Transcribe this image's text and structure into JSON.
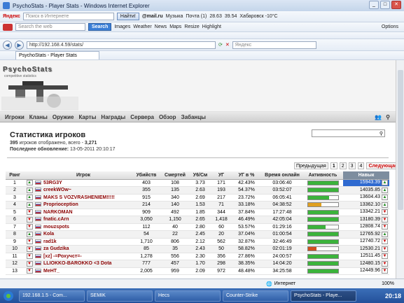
{
  "window": {
    "title": "PsychoStats - Player Stats - Windows Internet Explorer"
  },
  "toolbar1": {
    "yandex": "Яндекс",
    "search_placeholder": "Поиск в Интернете",
    "find_btn": "Найти!",
    "mail": "@mail.ru",
    "music": "Музыка",
    "mailbox": "Почта (1)",
    "rate1": "28.63",
    "rate2": "39.54",
    "weather": "Хабаровск -10°C"
  },
  "toolbar2": {
    "search_placeholder": "Search the web",
    "search_btn": "Search",
    "images": "Images",
    "weather": "Weather",
    "news": "News",
    "maps": "Maps",
    "resize": "Resize",
    "highlight": "Highlight",
    "options": "Options"
  },
  "address": {
    "url": "http://192.168.4.59/stats/",
    "search_placeholder": "Яндекс"
  },
  "tab": {
    "label": "PsychoStats - Player Stats"
  },
  "site": {
    "logo": "PsychoStats",
    "logo_sub": "competitive statistics",
    "nav": [
      "Игроки",
      "Кланы",
      "Оружие",
      "Карты",
      "Награды",
      "Сервера",
      "Обзор",
      "Забанцы"
    ]
  },
  "stats": {
    "title": "Статистика игроков",
    "shown": "395",
    "shown_text": "игроков отображено, всего -",
    "total": "3,271",
    "updated_label": "Последнее обновление:",
    "updated_value": "13-05-2011 20:10:17"
  },
  "pager": {
    "prev": "Предыдущая",
    "pages": [
      "1",
      "2",
      "3",
      "4"
    ],
    "next": "Следующая"
  },
  "table": {
    "headers": [
      "Ранг",
      "",
      "Игрок",
      "Убийств",
      "Смертей",
      "У6/См",
      "УГ",
      "УГ в %",
      "Время онлайн",
      "Активность",
      "Навык"
    ],
    "rows": [
      {
        "rank": "1",
        "dir": "up",
        "name": "53RG3Y",
        "kills": "403",
        "deaths": "108",
        "kd": "3.73",
        "hs": "171",
        "hsp": "42.43%",
        "time": "03:06:40",
        "act": 1.0,
        "actcolor": "#3bb33b",
        "skill": "15943.39"
      },
      {
        "rank": "2",
        "dir": "up",
        "name": "creekWOw~",
        "kills": "355",
        "deaths": "135",
        "kd": "2.63",
        "hs": "193",
        "hsp": "54.37%",
        "time": "03:52:07",
        "act": 1.0,
        "actcolor": "#3bb33b",
        "skill": "14035.85"
      },
      {
        "rank": "3",
        "dir": "up",
        "name": "MAKS S VOZVRASHENIEM!!!!!",
        "kills": "915",
        "deaths": "340",
        "kd": "2.69",
        "hs": "217",
        "hsp": "23.72%",
        "time": "06:05:41",
        "act": 0.72,
        "actcolor": "#3bb33b",
        "skill": "13604.43"
      },
      {
        "rank": "4",
        "dir": "up",
        "name": "Proprioception",
        "kills": "214",
        "deaths": "140",
        "kd": "1.53",
        "hs": "71",
        "hsp": "33.18%",
        "time": "04:38:52",
        "act": 0.45,
        "actcolor": "#e0a020",
        "skill": "13362.10"
      },
      {
        "rank": "5",
        "dir": "dn",
        "name": "NARKOMAN",
        "kills": "909",
        "deaths": "492",
        "kd": "1.85",
        "hs": "344",
        "hsp": "37.84%",
        "time": "17:27:48",
        "act": 1.0,
        "actcolor": "#3bb33b",
        "skill": "13342.21"
      },
      {
        "rank": "6",
        "dir": "dn",
        "name": "fnatic.cArn",
        "kills": "3,050",
        "deaths": "1,150",
        "kd": "2.65",
        "hs": "1,418",
        "hsp": "46.49%",
        "time": "42:05:04",
        "act": 1.0,
        "actcolor": "#3bb33b",
        "skill": "13180.39"
      },
      {
        "rank": "7",
        "dir": "dn",
        "name": "mouzspots",
        "kills": "112",
        "deaths": "40",
        "kd": "2.80",
        "hs": "60",
        "hsp": "53.57%",
        "time": "01:29:16",
        "act": 0.6,
        "actcolor": "#3bb33b",
        "skill": "12808.74"
      },
      {
        "rank": "8",
        "dir": "up",
        "name": "Kola",
        "kills": "54",
        "deaths": "22",
        "kd": "2.45",
        "hs": "20",
        "hsp": "37.04%",
        "time": "01:00:54",
        "act": 1.0,
        "actcolor": "#3bb33b",
        "skill": "12765.92"
      },
      {
        "rank": "9",
        "dir": "dn",
        "name": "rad1k",
        "kills": "1,710",
        "deaths": "806",
        "kd": "2.12",
        "hs": "562",
        "hsp": "32.87%",
        "time": "32:46:49",
        "act": 1.0,
        "actcolor": "#3bb33b",
        "skill": "12740.72"
      },
      {
        "rank": "10",
        "dir": "dn",
        "name": "za Gudzika",
        "kills": "85",
        "deaths": "35",
        "kd": "2.43",
        "hs": "50",
        "hsp": "58.82%",
        "time": "02:01:19",
        "act": 0.3,
        "actcolor": "#d05020",
        "skill": "12530.21"
      },
      {
        "rank": "11",
        "dir": "dn",
        "name": "[xz] -=Рохучст=-",
        "kills": "1,278",
        "deaths": "556",
        "kd": "2.30",
        "hs": "356",
        "hsp": "27.86%",
        "time": "24:00:57",
        "act": 1.0,
        "actcolor": "#3bb33b",
        "skill": "12511.45"
      },
      {
        "rank": "12",
        "dir": "dn",
        "name": "LLIOKKO-BAROKKO <3 Dota",
        "kills": "777",
        "deaths": "457",
        "kd": "1.70",
        "hs": "298",
        "hsp": "38.35%",
        "time": "14:04:20",
        "act": 1.0,
        "actcolor": "#3bb33b",
        "skill": "12480.15"
      },
      {
        "rank": "13",
        "dir": "dn",
        "name": "MeHT_",
        "kills": "2,005",
        "deaths": "959",
        "kd": "2.09",
        "hs": "972",
        "hsp": "48.48%",
        "time": "34:25:58",
        "act": 1.0,
        "actcolor": "#3bb33b",
        "skill": "12449.96"
      }
    ]
  },
  "status": {
    "zone": "Интернет",
    "zoom": "100%"
  },
  "taskbar": {
    "items": [
      "192.168.1.5 - Com...",
      "SEMIK",
      "Hecs",
      "Counter-Strike",
      "PsychoStats - Playe..."
    ],
    "clock": "20:18"
  }
}
